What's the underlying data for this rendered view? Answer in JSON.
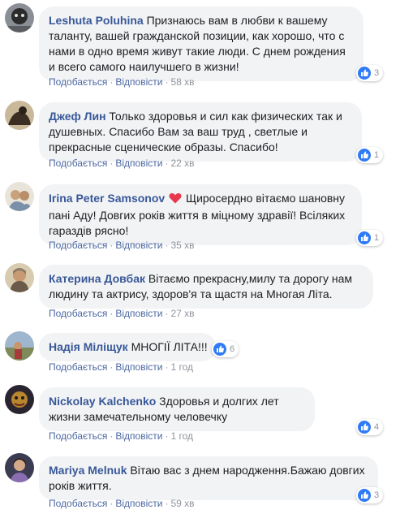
{
  "actions": {
    "reply": "Подобається",
    "respond": "Відповісти",
    "sep": "·"
  },
  "colors": {
    "author": "#385898",
    "bubble": "#f2f3f5",
    "link": "#4b67a1",
    "like": "#2f7bf6",
    "heart": "#e8384f"
  },
  "comments": [
    {
      "author": "Leshuta Poluhina",
      "text": "Признаюсь вам в любви к вашему таланту, вашей гражданской позиции, как хорошо, что с нами в одно время живут такие люди. С днем рождения и всего самого наилучшего в жизни!",
      "time": "58 хв",
      "reactions": "3"
    },
    {
      "author": "Джеф Лин",
      "text": "Только здоровья и сил как физических так и душевных. Спасибо Вам за ваш труд , светлые и прекрасные сценические образы. Спасибо!",
      "time": "22 хв",
      "reactions": "1"
    },
    {
      "author": "Irina Peter Samsonov",
      "text": "Щиросердно вітаємо шановну пані Аду! Довгих років життя в міцному здравії! Всіляких гараздів рясно!",
      "time": "35 хв",
      "reactions": "1"
    },
    {
      "author": "Катерина Довбак",
      "text": "Вітаємо прекрасну,милу та дорогу нам людину та актрису, здоров'я та щастя на Многая Літа.",
      "time": "27 хв",
      "reactions": ""
    },
    {
      "author": "Надія Міліщук",
      "text": "МНОГІЇ ЛІТА!!!",
      "time": "1 год",
      "reactions": "6"
    },
    {
      "author": "Nickolay Kalchenko",
      "text": "Здоровья и долгих лет жизни замечательному человечку",
      "time": "1 год",
      "reactions": "4"
    },
    {
      "author": "Mariya Melnuk",
      "text": "Вітаю вас з днем народження.Бажаю довгих років життя.",
      "time": "59 хв",
      "reactions": "3"
    }
  ]
}
